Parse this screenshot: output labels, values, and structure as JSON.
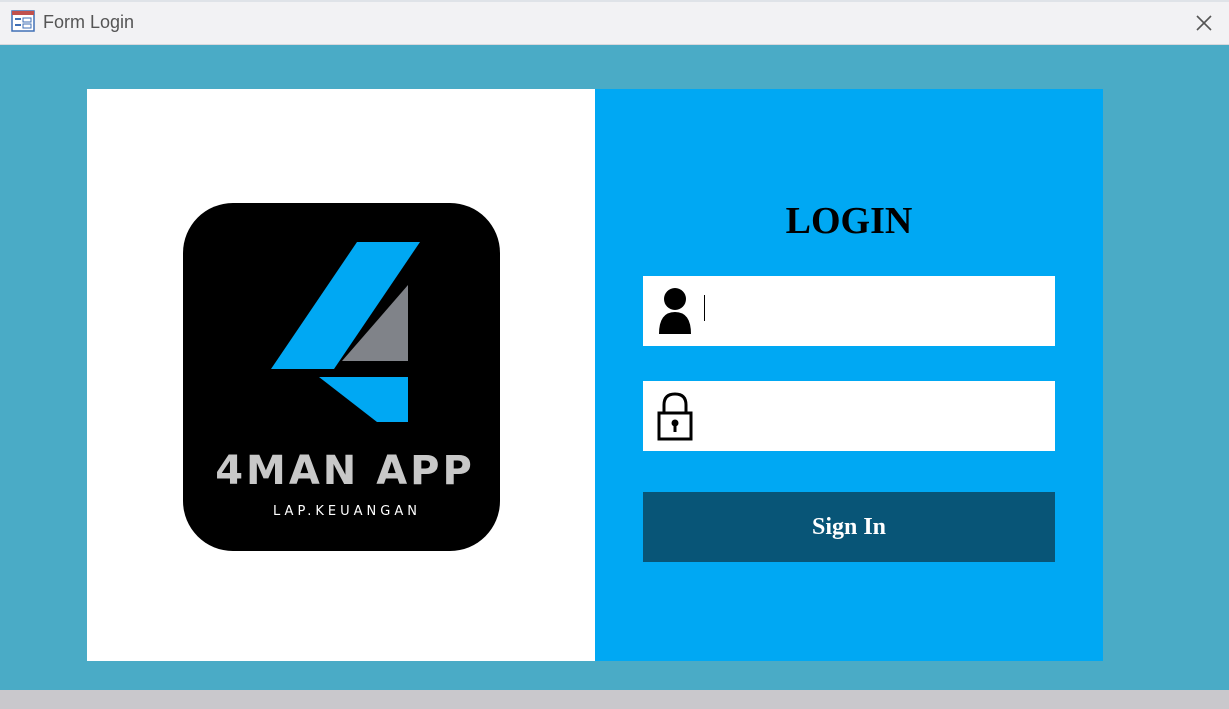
{
  "window": {
    "title": "Form Login",
    "app_icon": "form-icon",
    "close_icon": "close-icon"
  },
  "logo": {
    "brand_name": "4MAN APP",
    "tagline": "LAP.KEUANGAN",
    "colors": {
      "background": "#000000",
      "accent_blue": "#00a8f3",
      "accent_gray": "#808389",
      "text": "#c8c8c8"
    }
  },
  "login": {
    "heading": "LOGIN",
    "username": {
      "icon": "user-icon",
      "value": "",
      "placeholder": ""
    },
    "password": {
      "icon": "lock-icon",
      "value": "",
      "placeholder": ""
    },
    "signin_label": "Sign In"
  },
  "colors": {
    "form_background": "#4aabc6",
    "right_panel": "#00a8f3",
    "button": "#085577",
    "left_panel": "#ffffff"
  }
}
